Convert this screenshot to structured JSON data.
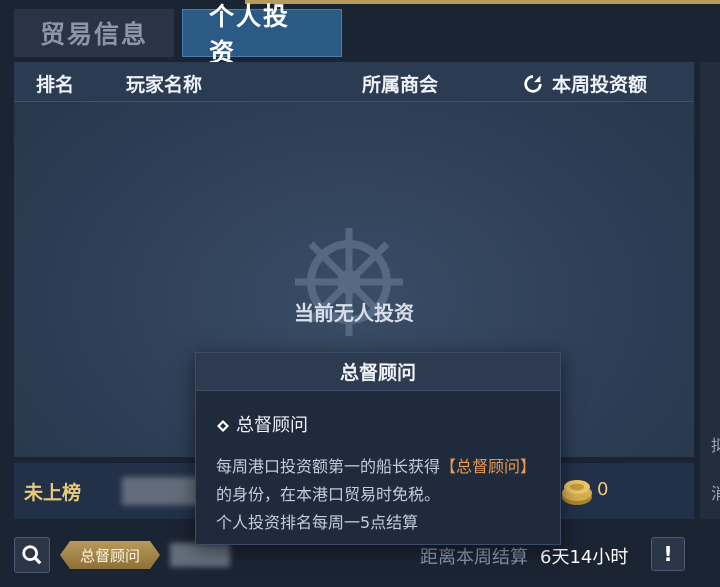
{
  "tabs": [
    {
      "label": "贸易信息",
      "active": false
    },
    {
      "label": "个人投资",
      "active": true
    }
  ],
  "table": {
    "headers": {
      "rank": "排名",
      "player_name": "玩家名称",
      "guild": "所属商会",
      "weekly_investment": "本周投资额"
    },
    "empty_message": "当前无人投资"
  },
  "self_row": {
    "rank": "未上榜",
    "amount": "0"
  },
  "side_labels": [
    "拟",
    "消"
  ],
  "bottom": {
    "title_badge": "总督顾问",
    "settle_label": "距离本周结算",
    "settle_time": "6天14小时",
    "info_label": "!"
  },
  "tooltip": {
    "header": "总督顾问",
    "subtitle": "总督顾问",
    "body_pre": "每周港口投资额第一的船长获得",
    "body_highlight": "【总督顾问】",
    "body_post": "的身份，在本港口贸易时免税。",
    "body_line2": "个人投资排名每周一5点结算"
  },
  "colors": {
    "accent_gold": "#e9c97b",
    "highlight_orange": "#e99a4d",
    "active_tab": "#2c5a86"
  },
  "icons": [
    "refresh-icon",
    "ship-wheel-icon",
    "coin-icon",
    "search-icon",
    "diamond-icon"
  ]
}
